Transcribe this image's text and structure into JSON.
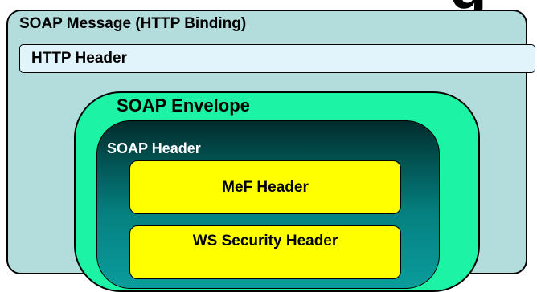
{
  "title_fragment": "g",
  "soap_message": {
    "label": "SOAP Message (HTTP Binding)"
  },
  "http_header": {
    "label": "HTTP Header"
  },
  "soap_envelope": {
    "label": "SOAP Envelope"
  },
  "soap_header": {
    "label": "SOAP Header",
    "blocks": [
      {
        "label": "MeF Header"
      },
      {
        "label": "WS Security Header"
      }
    ]
  },
  "colors": {
    "message_fill": "#b3dcdc",
    "http_header_fill": "#e1f4fc",
    "envelope_fill": "#1cf3a4",
    "soap_header_fill": "#046c6c",
    "block_fill": "#ffff00"
  }
}
